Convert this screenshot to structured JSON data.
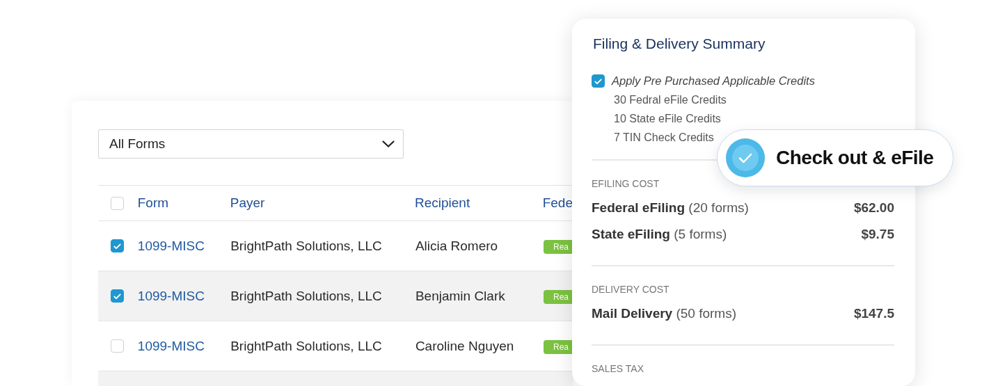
{
  "filter": {
    "value": "All Forms"
  },
  "table": {
    "select_all": {
      "checked": false
    },
    "columns": [
      "Form",
      "Payer",
      "Recipient",
      "Fede"
    ],
    "rows": [
      {
        "checked": true,
        "selected": false,
        "form": "1099-MISC",
        "payer": "BrightPath Solutions, LLC",
        "recipient": "Alicia Romero",
        "status": "Rea"
      },
      {
        "checked": true,
        "selected": true,
        "form": "1099-MISC",
        "payer": "BrightPath Solutions, LLC",
        "recipient": "Benjamin Clark",
        "status": "Rea"
      },
      {
        "checked": false,
        "selected": false,
        "form": "1099-MISC",
        "payer": "BrightPath Solutions, LLC",
        "recipient": "Caroline Nguyen",
        "status": "Rea"
      },
      {
        "selected": true
      }
    ]
  },
  "summary": {
    "title": "Filing & Delivery Summary",
    "credits": {
      "checked": true,
      "label": "Apply Pre Purchased Applicable Credits",
      "items": [
        "30 Fedral eFile Credits",
        "10 State eFile Credits",
        "7 TIN Check Credits"
      ]
    },
    "sections": [
      {
        "heading": "EFILING COST",
        "lines": [
          {
            "label": "Federal eFiling",
            "note": "(20 forms)",
            "amount": "$62.00"
          },
          {
            "label": "State eFiling",
            "note": "(5 forms)",
            "amount": "$9.75"
          }
        ]
      },
      {
        "heading": "DELIVERY COST",
        "lines": [
          {
            "label": "Mail Delivery",
            "note": "(50 forms)",
            "amount": "$147.5"
          }
        ]
      },
      {
        "heading": "SALES TAX"
      }
    ]
  },
  "checkout_button": {
    "label": "Check out & eFile"
  }
}
